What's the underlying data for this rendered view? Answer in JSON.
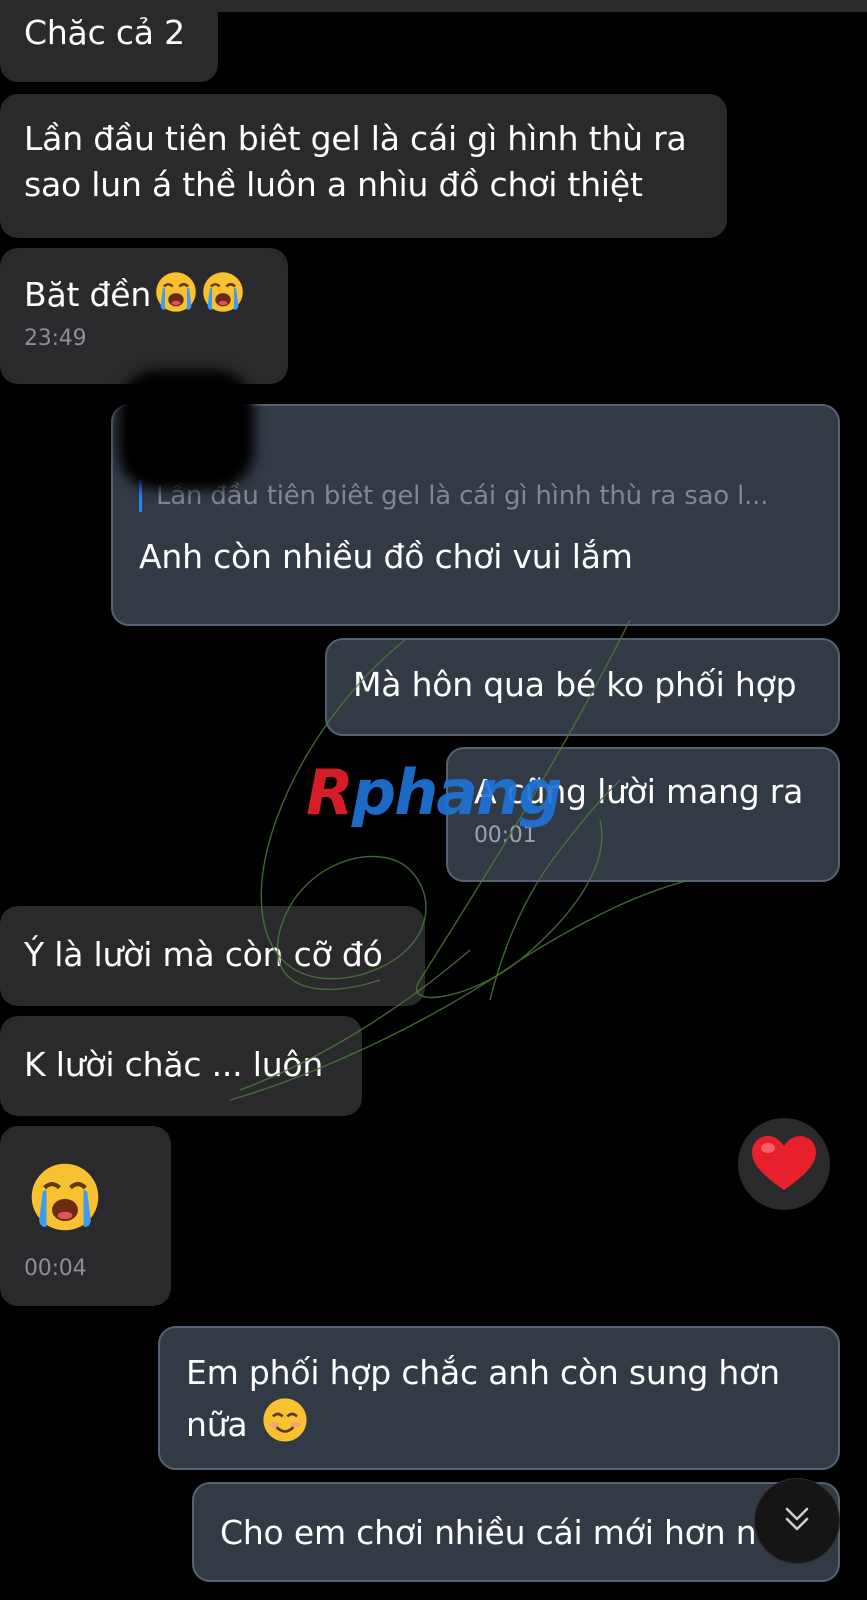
{
  "messages": {
    "m1": "Chăc cả 2",
    "m2_line1": "Lần đầu tiên biêt gel là cái gì hình thù ra",
    "m2_line2": "sao lun á thề luôn a nhìu đồ chơi thiệt",
    "m3": "Băt đền",
    "m3_time": "23:49",
    "m4_quote": "Lần đầu tiên biêt gel là cái gì hình thù ra sao l...",
    "m4": "Anh còn nhiều đồ chơi vui lắm",
    "m5": "Mà hôn qua bé ko phối hợp",
    "m6": "A cũng lười mang ra",
    "m6_time": "00:01",
    "m7": "Ý là lười mà còn cỡ đó",
    "m8": "K lười chăc ... luôn",
    "m9_time": "00:04",
    "m10_line1": "Em phối hợp chắc anh còn sung hơn",
    "m10_line2": "nữa",
    "m11": "Cho em chơi nhiều cái mới hơn n"
  },
  "watermark": {
    "first": "R",
    "rest": "phang"
  },
  "icons": {
    "cry_emoji": "loudly-crying-face",
    "smile_emoji": "smiling-face-with-smiling-eyes",
    "heart": "red-heart",
    "scroll_down": "chevron-double-down"
  },
  "colors": {
    "background": "#000000",
    "incoming_bubble": "#2a2a2c",
    "outgoing_bubble": "#323a46",
    "reply_accent": "#2f7df6",
    "heart": "#e8202c"
  }
}
